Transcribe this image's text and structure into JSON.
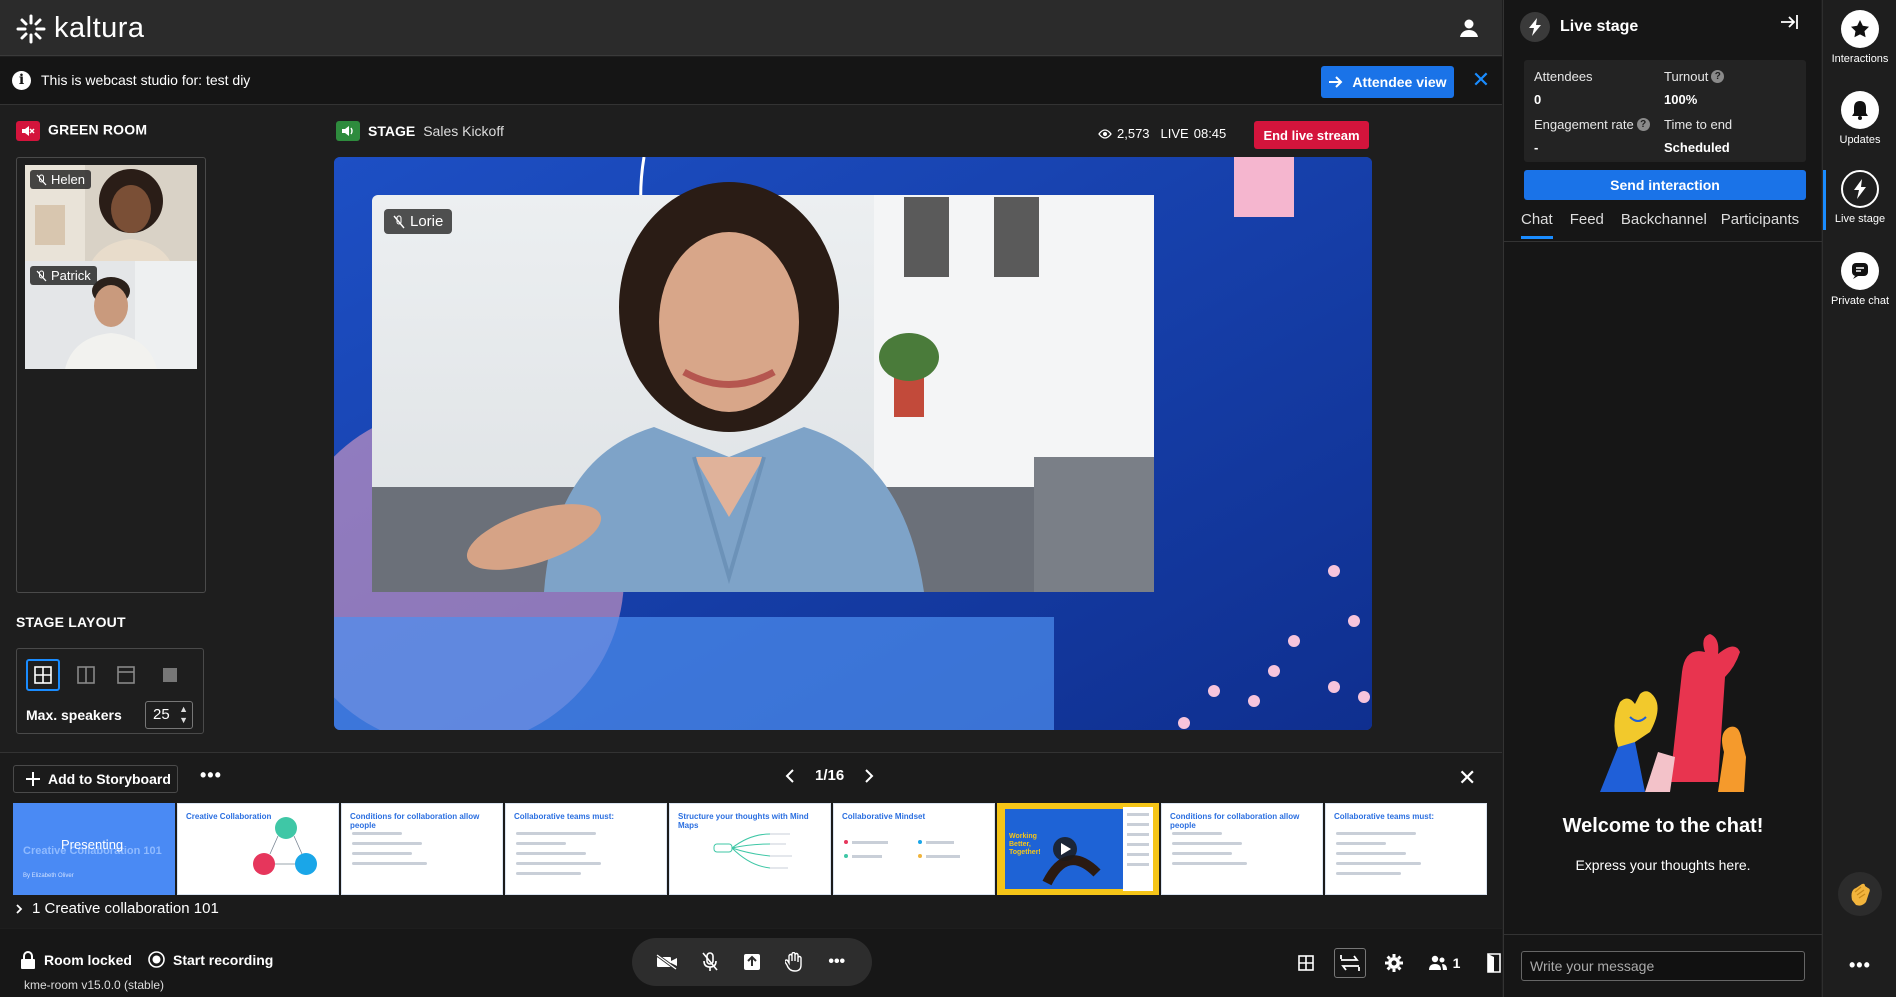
{
  "app": {
    "name": "kaltura"
  },
  "info_bar": {
    "message": "This is webcast studio for: test diy",
    "attendee_view_label": "Attendee view"
  },
  "green_room": {
    "title": "GREEN ROOM",
    "participants": [
      {
        "name": "Helen"
      },
      {
        "name": "Patrick"
      }
    ]
  },
  "stage_layout": {
    "title": "STAGE LAYOUT",
    "max_speakers_label": "Max. speakers",
    "max_speakers_value": "25"
  },
  "stage": {
    "title": "STAGE",
    "session_name": "Sales Kickoff",
    "viewer_count": "2,573",
    "live_label": "LIVE",
    "live_time": "08:45",
    "end_stream_label": "End live stream",
    "speaker_name": "Lorie"
  },
  "storyboard": {
    "add_label": "Add to Storyboard",
    "page_indicator": "1/16",
    "section_label": "1  Creative collaboration 101",
    "slides": [
      {
        "title": "Creative Collaboration 101",
        "badge": "Presenting",
        "subtitle": "By Elizabeth Oliver"
      },
      {
        "title": "Creative Collaboration"
      },
      {
        "title": "Conditions for collaboration allow people"
      },
      {
        "title": "Collaborative teams must:"
      },
      {
        "title": "Structure your thoughts with Mind Maps"
      },
      {
        "title": "Collaborative Mindset"
      },
      {
        "title": "Working Better, Together!"
      },
      {
        "title": "Conditions for collaboration allow people"
      },
      {
        "title": "Collaborative teams must:"
      }
    ]
  },
  "bottom_bar": {
    "room_locked_label": "Room locked",
    "start_recording_label": "Start recording",
    "version": "kme-room v15.0.0 (stable)",
    "participants_count": "1"
  },
  "right_panel": {
    "title": "Live stage",
    "stats": {
      "attendees_label": "Attendees",
      "attendees_value": "0",
      "turnout_label": "Turnout",
      "turnout_value": "100%",
      "engagement_label": "Engagement rate",
      "engagement_value": "-",
      "time_to_end_label": "Time to end",
      "time_to_end_value": "Scheduled"
    },
    "send_interaction_label": "Send interaction",
    "tabs": [
      "Chat",
      "Feed",
      "Backchannel",
      "Participants"
    ],
    "welcome_title": "Welcome to the chat!",
    "welcome_subtitle": "Express your thoughts here.",
    "chat_placeholder": "Write your message"
  },
  "rail": [
    {
      "label": "Interactions",
      "icon": "star-icon"
    },
    {
      "label": "Updates",
      "icon": "bell-icon"
    },
    {
      "label": "Live stage",
      "icon": "bolt-icon"
    },
    {
      "label": "Private chat",
      "icon": "chat-icon"
    }
  ],
  "colors": {
    "accent": "#1a73e8",
    "danger": "#d4143c",
    "stage_bg": "#1a47b8"
  }
}
